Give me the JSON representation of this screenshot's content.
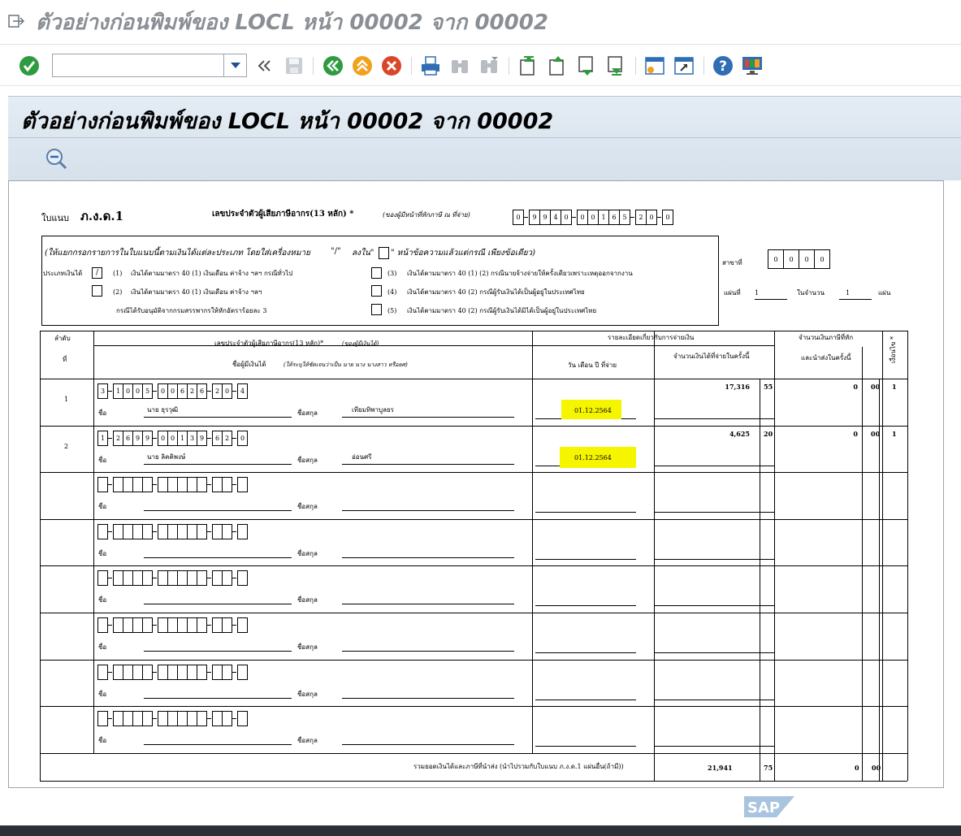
{
  "window": {
    "title": "ตัวอย่างก่อนพิมพ์ของ LOCL หน้า 00002 จาก 00002"
  },
  "toolbar": {
    "command_value": "",
    "icons": [
      "enter-icon",
      "command-dropdown-icon",
      "collapse-icon",
      "save-icon",
      "back-icon",
      "exit-icon",
      "cancel-icon",
      "print-icon",
      "find-icon",
      "find-next-icon",
      "first-page-icon",
      "previous-page-icon",
      "next-page-icon",
      "last-page-icon",
      "create-session-icon",
      "shortcut-icon",
      "help-icon",
      "layout-icon"
    ],
    "colors": {
      "green": "#2e9b3f",
      "orange": "#f0a21c",
      "red": "#d9472b",
      "blue": "#2f6db5"
    }
  },
  "content": {
    "title": "ตัวอย่างก่อนพิมพ์ของ LOCL หน้า 00002 จาก 00002",
    "zoom_icon": "zoom-out-icon"
  },
  "form": {
    "form_label": "ใบแนบ",
    "form_name": "ภ.ง.ด.1",
    "taxid_label": "เลขประจำตัวผู้เสียภาษีอากร(13 หลัก) *",
    "taxid_note": "(ของผู้มีหน้าที่หักภาษี ณ ที่จ่าย)",
    "taxid_digits": [
      "0",
      "9",
      "9",
      "4",
      "0",
      "0",
      "0",
      "1",
      "6",
      "5",
      "2",
      "0",
      "0"
    ],
    "instruction": "(ให้แยกกรอกรายการในใบแนบนี้ตามเงินได้แต่ละประเภท โดยใส่เครื่องหมาย",
    "check_mark_text": "\"/\"",
    "in_box_text": "ลงใน\"",
    "instruction_end": "\" หน้าข้อความแล้วแต่กรณี เพียงข้อเดียว)",
    "income_type_label": "ประเภทเงินได้",
    "checked_mark": "/",
    "options_left": [
      {
        "num": "(1)",
        "text": "เงินได้ตามมาตรา 40  (1) เงินเดือน ค่าจ้าง ฯลฯ กรณีทั่วไป"
      },
      {
        "num": "(2)",
        "text": "เงินได้ตามมาตรา 40  (1) เงินเดือน ค่าจ้าง ฯลฯ"
      }
    ],
    "option_left_note": "กรณีได้รับอนุมัติจากกรมสรรพากรให้หักอัตราร้อยละ 3",
    "options_right": [
      {
        "num": "(3)",
        "text": "เงินได้ตามมาตรา 40  (1)  (2) กรณีนายจ้างจ่ายให้ครั้งเดียวเพราะเหตุออกจากงาน"
      },
      {
        "num": "(4)",
        "text": "เงินได้ตามมาตรา 40  (2) กรณีผู้รับเงินได้เป็นผู้อยู่ในประเทศไทย"
      },
      {
        "num": "(5)",
        "text": "เงินได้ตามมาตรา 40  (2) กรณีผู้รับเงินได้มิได้เป็นผู้อยู่ในประเทศไทย"
      }
    ],
    "branch_label": "สาขาที่",
    "branch_digits": [
      "0",
      "0",
      "0",
      "0"
    ],
    "sheet_label": "แผ่นที่",
    "sheet_no": "1",
    "total_label": "ในจำนวน",
    "total_sheets": "1",
    "sheet_unit": "แผ่น",
    "table": {
      "h_seq_1": "ลำดับ",
      "h_seq_2": "ที่",
      "h_id": "เลขประจำตัวผู้เสียภาษีอากร(13 หลัก)*",
      "h_id_note": "(ของผู้มีเงินได้)",
      "h_name": "ชื่อผู้มีเงินได้",
      "h_name_note": "(ให้ระบุให้ชัดเจนว่าเป็น นาย นาง นางสาว หรือยศ)",
      "h_detail": "รายละเอียดเกี่ยวกับการจ่ายเงิน",
      "h_date": "วัน เดือน ปี ที่จ่าย",
      "h_amount": "จำนวนเงินได้ที่จ่ายในครั้งนี้",
      "h_tax_1": "จำนวนเงินภาษีที่หัก",
      "h_tax_2": "และนำส่งในครั้งนี้",
      "h_cond": "เงื่อนไข *",
      "first_name_label": "ชื่อ",
      "last_name_label": "ชื่อสกุล",
      "rows": [
        {
          "seq": "1",
          "id": [
            "3",
            "1",
            "0",
            "0",
            "5",
            "0",
            "0",
            "6",
            "2",
            "6",
            "2",
            "0",
            "4"
          ],
          "first": "นาย ธุรวุฒิ",
          "last": "เทียมทิพาบูลยร",
          "date": "01.12.2564",
          "amount": "17,316",
          "amount_dec": "55",
          "tax": "0",
          "tax_dec": "00",
          "cond": "1"
        },
        {
          "seq": "2",
          "id": [
            "1",
            "2",
            "6",
            "9",
            "9",
            "0",
            "0",
            "1",
            "3",
            "9",
            "6",
            "2",
            "0"
          ],
          "first": "นาย ลิคคิพงษ์",
          "last": "อ่อนศรี",
          "date": "01.12.2564",
          "amount": "4,625",
          "amount_dec": "20",
          "tax": "0",
          "tax_dec": "00",
          "cond": "1"
        },
        {
          "seq": "",
          "id": [
            "",
            "",
            "",
            "",
            "",
            "",
            "",
            "",
            "",
            "",
            "",
            "",
            ""
          ],
          "first": "",
          "last": "",
          "date": "",
          "amount": "",
          "amount_dec": "",
          "tax": "",
          "tax_dec": "",
          "cond": ""
        },
        {
          "seq": "",
          "id": [
            "",
            "",
            "",
            "",
            "",
            "",
            "",
            "",
            "",
            "",
            "",
            "",
            ""
          ],
          "first": "",
          "last": "",
          "date": "",
          "amount": "",
          "amount_dec": "",
          "tax": "",
          "tax_dec": "",
          "cond": ""
        },
        {
          "seq": "",
          "id": [
            "",
            "",
            "",
            "",
            "",
            "",
            "",
            "",
            "",
            "",
            "",
            "",
            ""
          ],
          "first": "",
          "last": "",
          "date": "",
          "amount": "",
          "amount_dec": "",
          "tax": "",
          "tax_dec": "",
          "cond": ""
        },
        {
          "seq": "",
          "id": [
            "",
            "",
            "",
            "",
            "",
            "",
            "",
            "",
            "",
            "",
            "",
            "",
            ""
          ],
          "first": "",
          "last": "",
          "date": "",
          "amount": "",
          "amount_dec": "",
          "tax": "",
          "tax_dec": "",
          "cond": ""
        },
        {
          "seq": "",
          "id": [
            "",
            "",
            "",
            "",
            "",
            "",
            "",
            "",
            "",
            "",
            "",
            "",
            ""
          ],
          "first": "",
          "last": "",
          "date": "",
          "amount": "",
          "amount_dec": "",
          "tax": "",
          "tax_dec": "",
          "cond": ""
        },
        {
          "seq": "",
          "id": [
            "",
            "",
            "",
            "",
            "",
            "",
            "",
            "",
            "",
            "",
            "",
            "",
            ""
          ],
          "first": "",
          "last": "",
          "date": "",
          "amount": "",
          "amount_dec": "",
          "tax": "",
          "tax_dec": "",
          "cond": ""
        }
      ],
      "summary_label": "รวมยอดเงินได้และภาษีที่นำส่ง (นำไปรวมกับใบแนบ ภ.ง.ด.1 แผ่นอื่น(ถ้ามี))",
      "summary_amount": "21,941",
      "summary_amount_dec": "75",
      "summary_tax": "0",
      "summary_tax_dec": "00"
    },
    "highlight_color": "#f6f500"
  },
  "footer": {
    "brand": "SAP"
  }
}
